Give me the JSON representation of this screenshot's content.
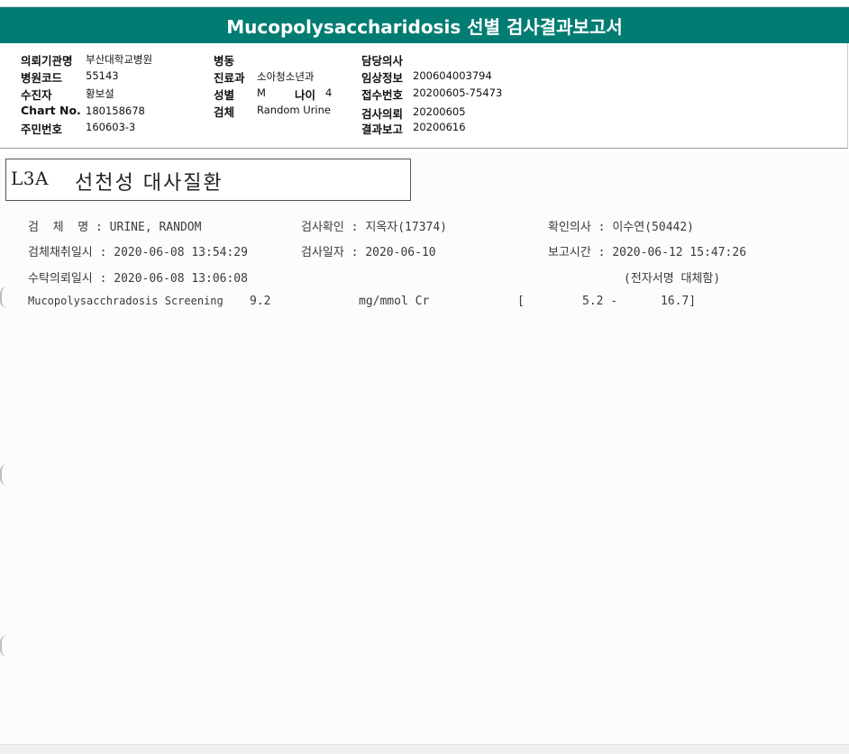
{
  "banner": {
    "title": "Mucopolysaccharidosis 선별 검사결과보고서"
  },
  "header": {
    "hospital_label": "의뢰기관명",
    "hospital_value": "부산대학교병원",
    "hospital_code_label": "병원코드",
    "hospital_code_value": "55143",
    "collector_label": "수진자",
    "collector_value": "황보설",
    "chart_label": "Chart No.",
    "chart_value": "180158678",
    "resident_label": "주민번호",
    "resident_value": "160603-3",
    "ward_label": "병동",
    "ward_value": "",
    "dept_label": "진료과",
    "dept_value": "소아청소년과",
    "sex_label": "성별",
    "sex_value": "M",
    "age_label": "나이",
    "age_value": "4",
    "specimen_label": "검체",
    "specimen_value": "Random Urine",
    "doctor_label": "담당의사",
    "doctor_value": "",
    "clinical_label": "임상정보",
    "clinical_value": "200604003794",
    "receipt_label": "접수번호",
    "receipt_value": "20200605-75473",
    "request_label": "검사의뢰",
    "request_value": "20200605",
    "report_label": "결과보고",
    "report_value": "20200616"
  },
  "report": {
    "code": "L3A",
    "title": "선천성 대사질환",
    "specimen_label": "검  체  명 : ",
    "specimen_value": "URINE, RANDOM",
    "verify_label": "검사확인 : ",
    "verify_value": "지옥자(17374)",
    "confirm_doctor_label": "확인의사 : ",
    "confirm_doctor_value": "이수연(50442)",
    "collect_time_label": "검체채취일시 : ",
    "collect_time_value": "2020-06-08 13:54:29",
    "test_date_label": "검사일자 : ",
    "test_date_value": "2020-06-10",
    "report_time_label": "보고시간 : ",
    "report_time_value": "2020-06-12 15:47:26",
    "request_time_label": "수탁의뢰일시 : ",
    "request_time_value": "2020-06-08 13:06:08",
    "esign_note": "(전자서명 대체함)",
    "results": [
      {
        "test": "Mucopolysacchradosis Screening",
        "value": "9.2",
        "unit": "mg/mmol Cr",
        "ref_open": "[",
        "ref_low": "5.2 -",
        "ref_high": "16.7]"
      }
    ]
  }
}
